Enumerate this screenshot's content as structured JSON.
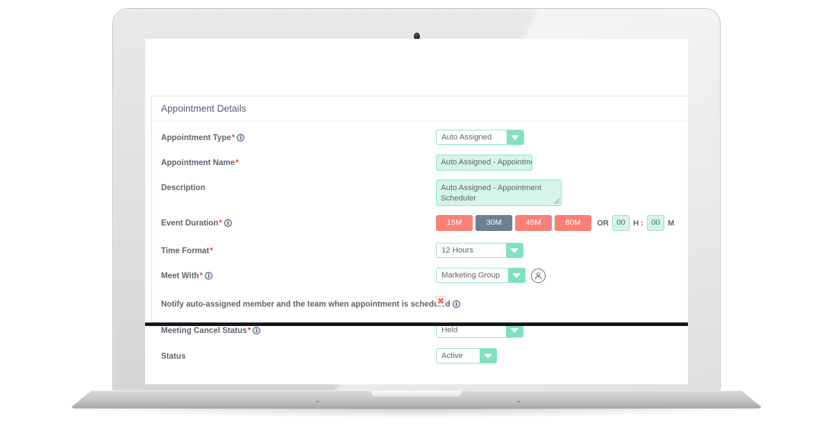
{
  "panel": {
    "title": "Appointment Details"
  },
  "form": {
    "appointment_type": {
      "label": "Appointment Type",
      "required": "*",
      "info": "i",
      "value": "Auto Assigned"
    },
    "appointment_name": {
      "label": "Appointment Name",
      "required": "*",
      "value": "Auto Assigned - Appointmen"
    },
    "description": {
      "label": "Description",
      "value": "Auto Assigned - Appointment Scheduler"
    },
    "event_duration": {
      "label": "Event Duration",
      "required": "*",
      "info": "i",
      "options": [
        "15M",
        "30M",
        "45M",
        "60M"
      ],
      "selected": "30M",
      "or_text": "OR",
      "hours_value": "00",
      "hours_unit": "H :",
      "minutes_value": "00",
      "minutes_unit": "M"
    },
    "time_format": {
      "label": "Time Format",
      "required": "*",
      "value": "12 Hours"
    },
    "meet_with": {
      "label": "Meet With",
      "required": "*",
      "info": "i",
      "value": "Marketing Group",
      "icon": "person-icon"
    },
    "notify": {
      "label": "Notify auto-assigned member and the team when appointment is scheduled",
      "info": "i",
      "checkbox_glyph": "✖"
    },
    "meeting_cancel_status": {
      "label": "Meeting Cancel Status",
      "required": "*",
      "info": "i",
      "value": "Held"
    },
    "status": {
      "label": "Status",
      "value": "Active"
    }
  },
  "colors": {
    "mint": "#7fe0c2",
    "mint_fill": "#d4f5e7",
    "mint_border": "#8fe3c8",
    "coral": "#f98077",
    "slate": "#6e7f8d",
    "label_text": "#5c6470",
    "required_red": "#e8453c"
  }
}
